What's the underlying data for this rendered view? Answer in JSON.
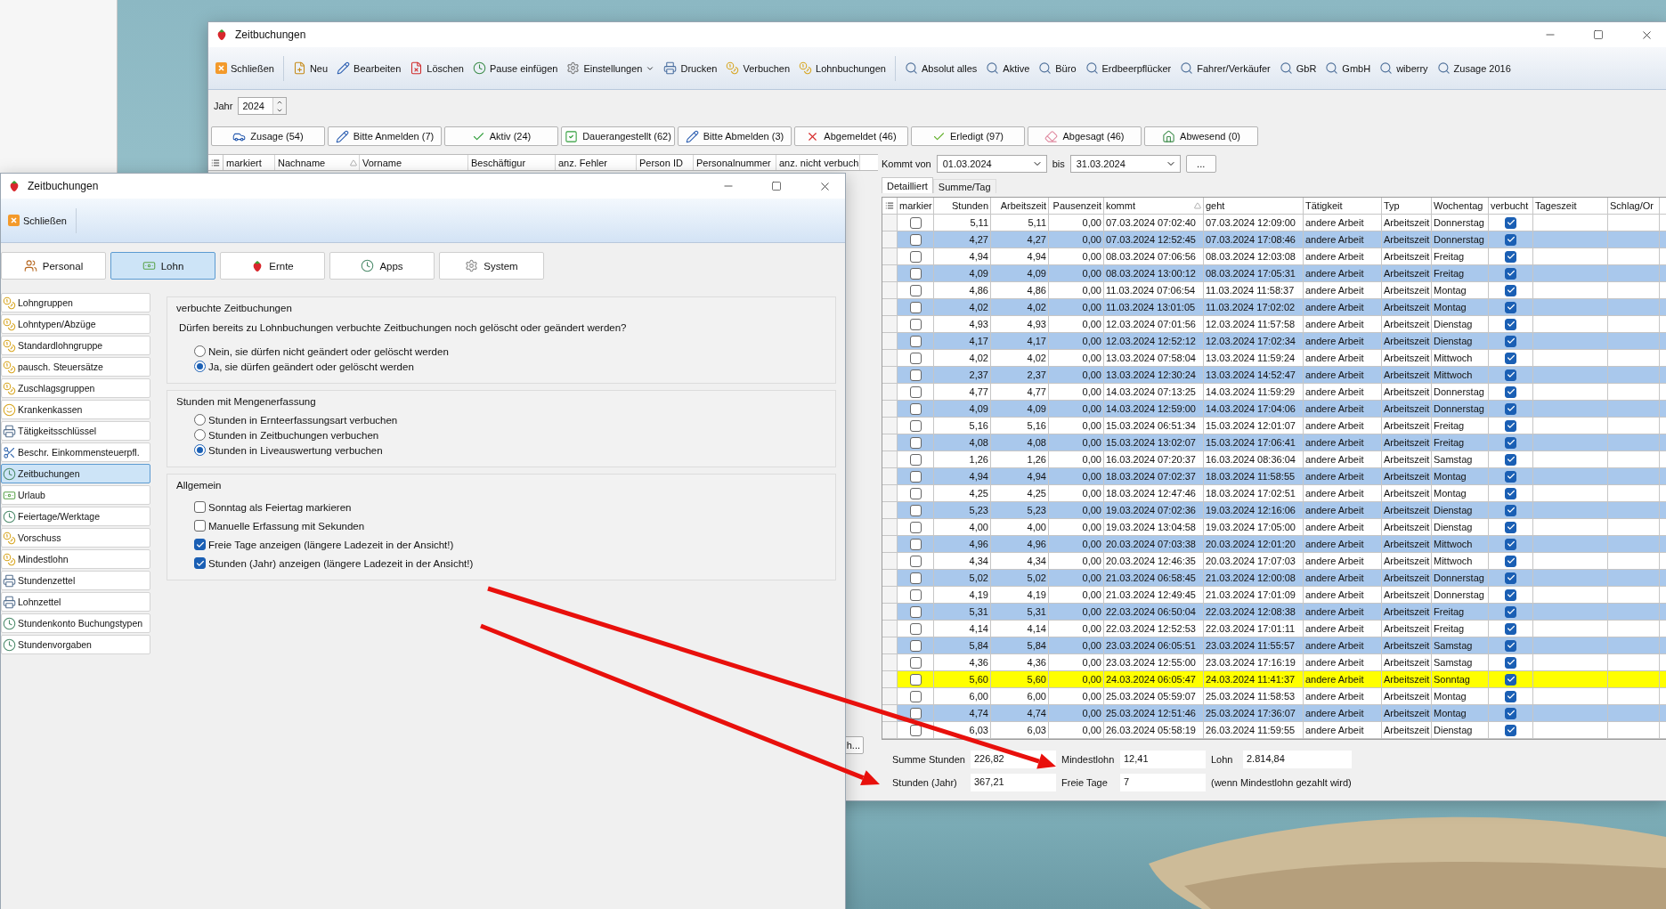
{
  "main_window": {
    "title": "Zeitbuchungen",
    "toolbar": [
      [
        {
          "label": "Schließen",
          "kind": "button"
        }
      ],
      [
        {
          "label": "Neu",
          "kind": "button"
        },
        {
          "label": "Bearbeiten",
          "kind": "button"
        },
        {
          "label": "Löschen",
          "kind": "button"
        },
        {
          "label": "Pause einfügen",
          "kind": "button"
        },
        {
          "label": "Einstellungen",
          "kind": "menu"
        },
        {
          "label": "Drucken",
          "kind": "button"
        },
        {
          "label": "Verbuchen",
          "kind": "button"
        },
        {
          "label": "Lohnbuchungen",
          "kind": "button"
        }
      ],
      [
        {
          "label": "Absolut alles",
          "kind": "button"
        },
        {
          "label": "Aktive",
          "kind": "button"
        },
        {
          "label": "Büro",
          "kind": "button"
        },
        {
          "label": "Erdbeerpflücker",
          "kind": "button"
        },
        {
          "label": "Fahrer/Verkäufer",
          "kind": "button"
        },
        {
          "label": "GbR",
          "kind": "button"
        },
        {
          "label": "GmbH",
          "kind": "button"
        },
        {
          "label": "wiberry",
          "kind": "button"
        },
        {
          "label": "Zusage 2016",
          "kind": "button"
        }
      ]
    ],
    "year": {
      "label": "Jahr",
      "value": "2024"
    },
    "status_buttons": [
      "Zusage (54)",
      "Bitte Anmelden (7)",
      "Aktiv (24)",
      "Dauerangestellt (62)",
      "Bitte Abmelden (3)",
      "Abgemeldet (46)",
      "Erledigt (97)",
      "Abgesagt (46)",
      "Abwesend (0)"
    ],
    "staff_table": {
      "columns": [
        {
          "label": "markiert",
          "sorted": false
        },
        {
          "label": "Nachname",
          "sorted": true
        },
        {
          "label": "Vorname",
          "sorted": false
        },
        {
          "label": "Beschäftigur",
          "sorted": false
        },
        {
          "label": "anz. Fehler",
          "sorted": false
        },
        {
          "label": "Person ID",
          "sorted": false
        },
        {
          "label": "Personalnummer",
          "sorted": false
        },
        {
          "label": "anz. nicht verbuch",
          "sorted": false
        }
      ]
    },
    "partial_button": "h...",
    "filter": {
      "from_label": "Kommt von",
      "from": "01.03.2024",
      "to_label": "bis",
      "to": "31.03.2024",
      "more": "..."
    },
    "view_tabs": [
      {
        "label": "Detailliert",
        "selected": true
      },
      {
        "label": "Summe/Tag",
        "selected": false
      }
    ],
    "bookings": {
      "columns": [
        {
          "label": "markier",
          "sorted": false
        },
        {
          "label": "Stunden",
          "sorted": false
        },
        {
          "label": "Arbeitszeit",
          "sorted": false
        },
        {
          "label": "Pausenzeit",
          "sorted": false
        },
        {
          "label": "kommt",
          "sorted": true
        },
        {
          "label": "geht",
          "sorted": false
        },
        {
          "label": "Tätigkeit",
          "sorted": false
        },
        {
          "label": "Typ",
          "sorted": false
        },
        {
          "label": "Wochentag",
          "sorted": false
        },
        {
          "label": "verbucht",
          "sorted": false
        },
        {
          "label": "Tageszeit",
          "sorted": false
        },
        {
          "label": "Schlag/Or",
          "sorted": false
        }
      ],
      "rows": [
        {
          "marked": false,
          "values": [
            "5,11",
            "5,11",
            "0,00",
            "07.03.2024 07:02:40",
            "07.03.2024 12:09:00",
            "andere Arbeit",
            "Arbeitszeit",
            "Donnerstag"
          ],
          "booked": true,
          "color": "#ffffff"
        },
        {
          "marked": false,
          "values": [
            "4,27",
            "4,27",
            "0,00",
            "07.03.2024 12:52:45",
            "07.03.2024 17:08:46",
            "andere Arbeit",
            "Arbeitszeit",
            "Donnerstag"
          ],
          "booked": true,
          "color": "#a9c8ec"
        },
        {
          "marked": false,
          "values": [
            "4,94",
            "4,94",
            "0,00",
            "08.03.2024 07:06:56",
            "08.03.2024 12:03:08",
            "andere Arbeit",
            "Arbeitszeit",
            "Freitag"
          ],
          "booked": true,
          "color": "#ffffff"
        },
        {
          "marked": false,
          "values": [
            "4,09",
            "4,09",
            "0,00",
            "08.03.2024 13:00:12",
            "08.03.2024 17:05:31",
            "andere Arbeit",
            "Arbeitszeit",
            "Freitag"
          ],
          "booked": true,
          "color": "#a9c8ec"
        },
        {
          "marked": false,
          "values": [
            "4,86",
            "4,86",
            "0,00",
            "11.03.2024 07:06:54",
            "11.03.2024 11:58:37",
            "andere Arbeit",
            "Arbeitszeit",
            "Montag"
          ],
          "booked": true,
          "color": "#ffffff"
        },
        {
          "marked": false,
          "values": [
            "4,02",
            "4,02",
            "0,00",
            "11.03.2024 13:01:05",
            "11.03.2024 17:02:02",
            "andere Arbeit",
            "Arbeitszeit",
            "Montag"
          ],
          "booked": true,
          "color": "#a9c8ec"
        },
        {
          "marked": false,
          "values": [
            "4,93",
            "4,93",
            "0,00",
            "12.03.2024 07:01:56",
            "12.03.2024 11:57:58",
            "andere Arbeit",
            "Arbeitszeit",
            "Dienstag"
          ],
          "booked": true,
          "color": "#ffffff"
        },
        {
          "marked": false,
          "values": [
            "4,17",
            "4,17",
            "0,00",
            "12.03.2024 12:52:12",
            "12.03.2024 17:02:34",
            "andere Arbeit",
            "Arbeitszeit",
            "Dienstag"
          ],
          "booked": true,
          "color": "#a9c8ec"
        },
        {
          "marked": false,
          "values": [
            "4,02",
            "4,02",
            "0,00",
            "13.03.2024 07:58:04",
            "13.03.2024 11:59:24",
            "andere Arbeit",
            "Arbeitszeit",
            "Mittwoch"
          ],
          "booked": true,
          "color": "#ffffff"
        },
        {
          "marked": false,
          "values": [
            "2,37",
            "2,37",
            "0,00",
            "13.03.2024 12:30:24",
            "13.03.2024 14:52:47",
            "andere Arbeit",
            "Arbeitszeit",
            "Mittwoch"
          ],
          "booked": true,
          "color": "#a9c8ec"
        },
        {
          "marked": false,
          "values": [
            "4,77",
            "4,77",
            "0,00",
            "14.03.2024 07:13:25",
            "14.03.2024 11:59:29",
            "andere Arbeit",
            "Arbeitszeit",
            "Donnerstag"
          ],
          "booked": true,
          "color": "#ffffff"
        },
        {
          "marked": false,
          "values": [
            "4,09",
            "4,09",
            "0,00",
            "14.03.2024 12:59:00",
            "14.03.2024 17:04:06",
            "andere Arbeit",
            "Arbeitszeit",
            "Donnerstag"
          ],
          "booked": true,
          "color": "#a9c8ec"
        },
        {
          "marked": false,
          "values": [
            "5,16",
            "5,16",
            "0,00",
            "15.03.2024 06:51:34",
            "15.03.2024 12:01:07",
            "andere Arbeit",
            "Arbeitszeit",
            "Freitag"
          ],
          "booked": true,
          "color": "#ffffff"
        },
        {
          "marked": false,
          "values": [
            "4,08",
            "4,08",
            "0,00",
            "15.03.2024 13:02:07",
            "15.03.2024 17:06:41",
            "andere Arbeit",
            "Arbeitszeit",
            "Freitag"
          ],
          "booked": true,
          "color": "#a9c8ec"
        },
        {
          "marked": false,
          "values": [
            "1,26",
            "1,26",
            "0,00",
            "16.03.2024 07:20:37",
            "16.03.2024 08:36:04",
            "andere Arbeit",
            "Arbeitszeit",
            "Samstag"
          ],
          "booked": true,
          "color": "#ffffff"
        },
        {
          "marked": false,
          "values": [
            "4,94",
            "4,94",
            "0,00",
            "18.03.2024 07:02:37",
            "18.03.2024 11:58:55",
            "andere Arbeit",
            "Arbeitszeit",
            "Montag"
          ],
          "booked": true,
          "color": "#a9c8ec"
        },
        {
          "marked": false,
          "values": [
            "4,25",
            "4,25",
            "0,00",
            "18.03.2024 12:47:46",
            "18.03.2024 17:02:51",
            "andere Arbeit",
            "Arbeitszeit",
            "Montag"
          ],
          "booked": true,
          "color": "#ffffff"
        },
        {
          "marked": false,
          "values": [
            "5,23",
            "5,23",
            "0,00",
            "19.03.2024 07:02:36",
            "19.03.2024 12:16:06",
            "andere Arbeit",
            "Arbeitszeit",
            "Dienstag"
          ],
          "booked": true,
          "color": "#a9c8ec"
        },
        {
          "marked": false,
          "values": [
            "4,00",
            "4,00",
            "0,00",
            "19.03.2024 13:04:58",
            "19.03.2024 17:05:00",
            "andere Arbeit",
            "Arbeitszeit",
            "Dienstag"
          ],
          "booked": true,
          "color": "#ffffff"
        },
        {
          "marked": false,
          "values": [
            "4,96",
            "4,96",
            "0,00",
            "20.03.2024 07:03:38",
            "20.03.2024 12:01:20",
            "andere Arbeit",
            "Arbeitszeit",
            "Mittwoch"
          ],
          "booked": true,
          "color": "#a9c8ec"
        },
        {
          "marked": false,
          "values": [
            "4,34",
            "4,34",
            "0,00",
            "20.03.2024 12:46:35",
            "20.03.2024 17:07:03",
            "andere Arbeit",
            "Arbeitszeit",
            "Mittwoch"
          ],
          "booked": true,
          "color": "#ffffff"
        },
        {
          "marked": false,
          "values": [
            "5,02",
            "5,02",
            "0,00",
            "21.03.2024 06:58:45",
            "21.03.2024 12:00:08",
            "andere Arbeit",
            "Arbeitszeit",
            "Donnerstag"
          ],
          "booked": true,
          "color": "#a9c8ec"
        },
        {
          "marked": false,
          "values": [
            "4,19",
            "4,19",
            "0,00",
            "21.03.2024 12:49:45",
            "21.03.2024 17:01:09",
            "andere Arbeit",
            "Arbeitszeit",
            "Donnerstag"
          ],
          "booked": true,
          "color": "#ffffff"
        },
        {
          "marked": false,
          "values": [
            "5,31",
            "5,31",
            "0,00",
            "22.03.2024 06:50:04",
            "22.03.2024 12:08:38",
            "andere Arbeit",
            "Arbeitszeit",
            "Freitag"
          ],
          "booked": true,
          "color": "#a9c8ec"
        },
        {
          "marked": false,
          "values": [
            "4,14",
            "4,14",
            "0,00",
            "22.03.2024 12:52:53",
            "22.03.2024 17:01:11",
            "andere Arbeit",
            "Arbeitszeit",
            "Freitag"
          ],
          "booked": true,
          "color": "#ffffff"
        },
        {
          "marked": false,
          "values": [
            "5,84",
            "5,84",
            "0,00",
            "23.03.2024 06:05:51",
            "23.03.2024 11:55:57",
            "andere Arbeit",
            "Arbeitszeit",
            "Samstag"
          ],
          "booked": true,
          "color": "#a9c8ec"
        },
        {
          "marked": false,
          "values": [
            "4,36",
            "4,36",
            "0,00",
            "23.03.2024 12:55:00",
            "23.03.2024 17:16:19",
            "andere Arbeit",
            "Arbeitszeit",
            "Samstag"
          ],
          "booked": true,
          "color": "#ffffff"
        },
        {
          "marked": false,
          "values": [
            "5,60",
            "5,60",
            "0,00",
            "24.03.2024 06:05:47",
            "24.03.2024 11:41:37",
            "andere Arbeit",
            "Arbeitszeit",
            "Sonntag"
          ],
          "booked": true,
          "color": "#ffff00"
        },
        {
          "marked": false,
          "values": [
            "6,00",
            "6,00",
            "0,00",
            "25.03.2024 05:59:07",
            "25.03.2024 11:58:53",
            "andere Arbeit",
            "Arbeitszeit",
            "Montag"
          ],
          "booked": true,
          "color": "#ffffff"
        },
        {
          "marked": false,
          "values": [
            "4,74",
            "4,74",
            "0,00",
            "25.03.2024 12:51:46",
            "25.03.2024 17:36:07",
            "andere Arbeit",
            "Arbeitszeit",
            "Montag"
          ],
          "booked": true,
          "color": "#a9c8ec"
        },
        {
          "marked": false,
          "values": [
            "6,03",
            "6,03",
            "0,00",
            "26.03.2024 05:58:19",
            "26.03.2024 11:59:55",
            "andere Arbeit",
            "Arbeitszeit",
            "Dienstag"
          ],
          "booked": true,
          "color": "#ffffff"
        }
      ]
    },
    "summary": {
      "fields": [
        {
          "label": "Summe Stunden",
          "value": "226,82"
        },
        {
          "label": "Mindestlohn",
          "value": "12,41"
        },
        {
          "label": "Lohn",
          "value": "2.814,84"
        },
        {
          "label": "Stunden (Jahr)",
          "value": "367,21"
        },
        {
          "label": "Freie Tage",
          "value": "7"
        }
      ],
      "note": "(wenn Mindestlohn gezahlt wird)"
    }
  },
  "settings_dialog": {
    "title": "Zeitbuchungen",
    "toolbar": [
      "Schließen"
    ],
    "tabs": [
      {
        "label": "Personal",
        "selected": false
      },
      {
        "label": "Lohn",
        "selected": true
      },
      {
        "label": "Ernte",
        "selected": false
      },
      {
        "label": "Apps",
        "selected": false
      },
      {
        "label": "System",
        "selected": false
      }
    ],
    "nav": [
      {
        "label": "Lohngruppen",
        "selected": false
      },
      {
        "label": "Lohntypen/Abzüge",
        "selected": false
      },
      {
        "label": "Standardlohngruppe",
        "selected": false
      },
      {
        "label": "pausch. Steuersätze",
        "selected": false
      },
      {
        "label": "Zuschlagsgruppen",
        "selected": false
      },
      {
        "label": "Krankenkassen",
        "selected": false
      },
      {
        "label": "Tätigkeitsschlüssel",
        "selected": false
      },
      {
        "label": "Beschr. Einkommensteuerpfl.",
        "selected": false
      },
      {
        "label": "Zeitbuchungen",
        "selected": true
      },
      {
        "label": "Urlaub",
        "selected": false
      },
      {
        "label": "Feiertage/Werktage",
        "selected": false
      },
      {
        "label": "Vorschuss",
        "selected": false
      },
      {
        "label": "Mindestlohn",
        "selected": false
      },
      {
        "label": "Stundenzettel",
        "selected": false
      },
      {
        "label": "Lohnzettel",
        "selected": false
      },
      {
        "label": "Stundenkonto Buchungstypen",
        "selected": false
      },
      {
        "label": "Stundenvorgaben",
        "selected": false
      }
    ],
    "groups": [
      {
        "title": "verbuchte Zeitbuchungen",
        "question": "Dürfen bereits zu Lohnbuchungen verbuchte Zeitbuchungen noch gelöscht oder geändert werden?",
        "options": [
          {
            "kind": "radio",
            "label": "Nein, sie dürfen nicht geändert oder gelöscht werden",
            "selected": false
          },
          {
            "kind": "radio",
            "label": "Ja, sie dürfen geändert oder gelöscht werden",
            "selected": true
          }
        ]
      },
      {
        "title": "Stunden mit Mengenerfassung",
        "options": [
          {
            "kind": "radio",
            "label": "Stunden in Ernteerfassungsart verbuchen",
            "selected": false
          },
          {
            "kind": "radio",
            "label": "Stunden in Zeitbuchungen verbuchen",
            "selected": false
          },
          {
            "kind": "radio",
            "label": "Stunden in Liveauswertung verbuchen",
            "selected": true
          }
        ]
      },
      {
        "title": "Allgemein",
        "options": [
          {
            "kind": "checkbox",
            "label": "Sonntag als Feiertag markieren",
            "checked": false
          },
          {
            "kind": "checkbox",
            "label": "Manuelle Erfassung mit Sekunden",
            "checked": false
          },
          {
            "kind": "checkbox",
            "label": "Freie Tage anzeigen (längere Ladezeit in der Ansicht!)",
            "checked": true
          },
          {
            "kind": "checkbox",
            "label": "Stunden (Jahr) anzeigen (längere Ladezeit in der Ansicht!)",
            "checked": true
          }
        ]
      }
    ]
  }
}
